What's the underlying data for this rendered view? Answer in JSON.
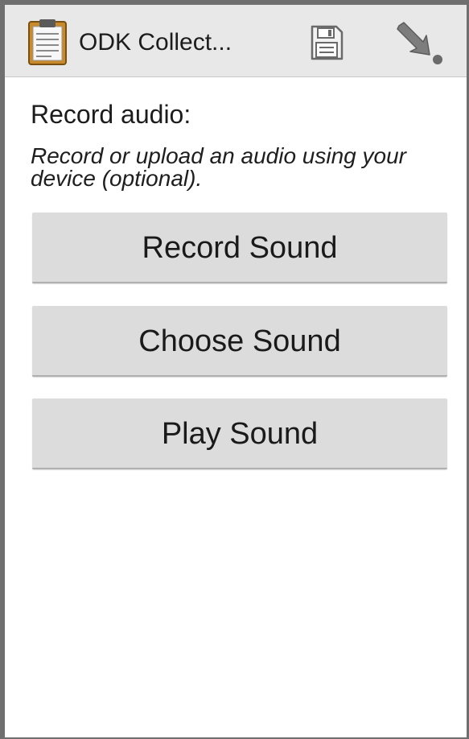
{
  "action_bar": {
    "title": "ODK Collect...",
    "icons": {
      "app": "clipboard-icon",
      "save": "save-icon",
      "go_to": "go-to-arrow-icon"
    },
    "background_color": "#e8e8e8"
  },
  "question": {
    "label": "Record audio:",
    "hint": "Record or upload an audio using your device (optional)."
  },
  "buttons": {
    "record_label": "Record Sound",
    "choose_label": "Choose Sound",
    "play_label": "Play Sound"
  },
  "colors": {
    "button_background": "#dcdcdc",
    "frame": "#6f6f6f"
  }
}
